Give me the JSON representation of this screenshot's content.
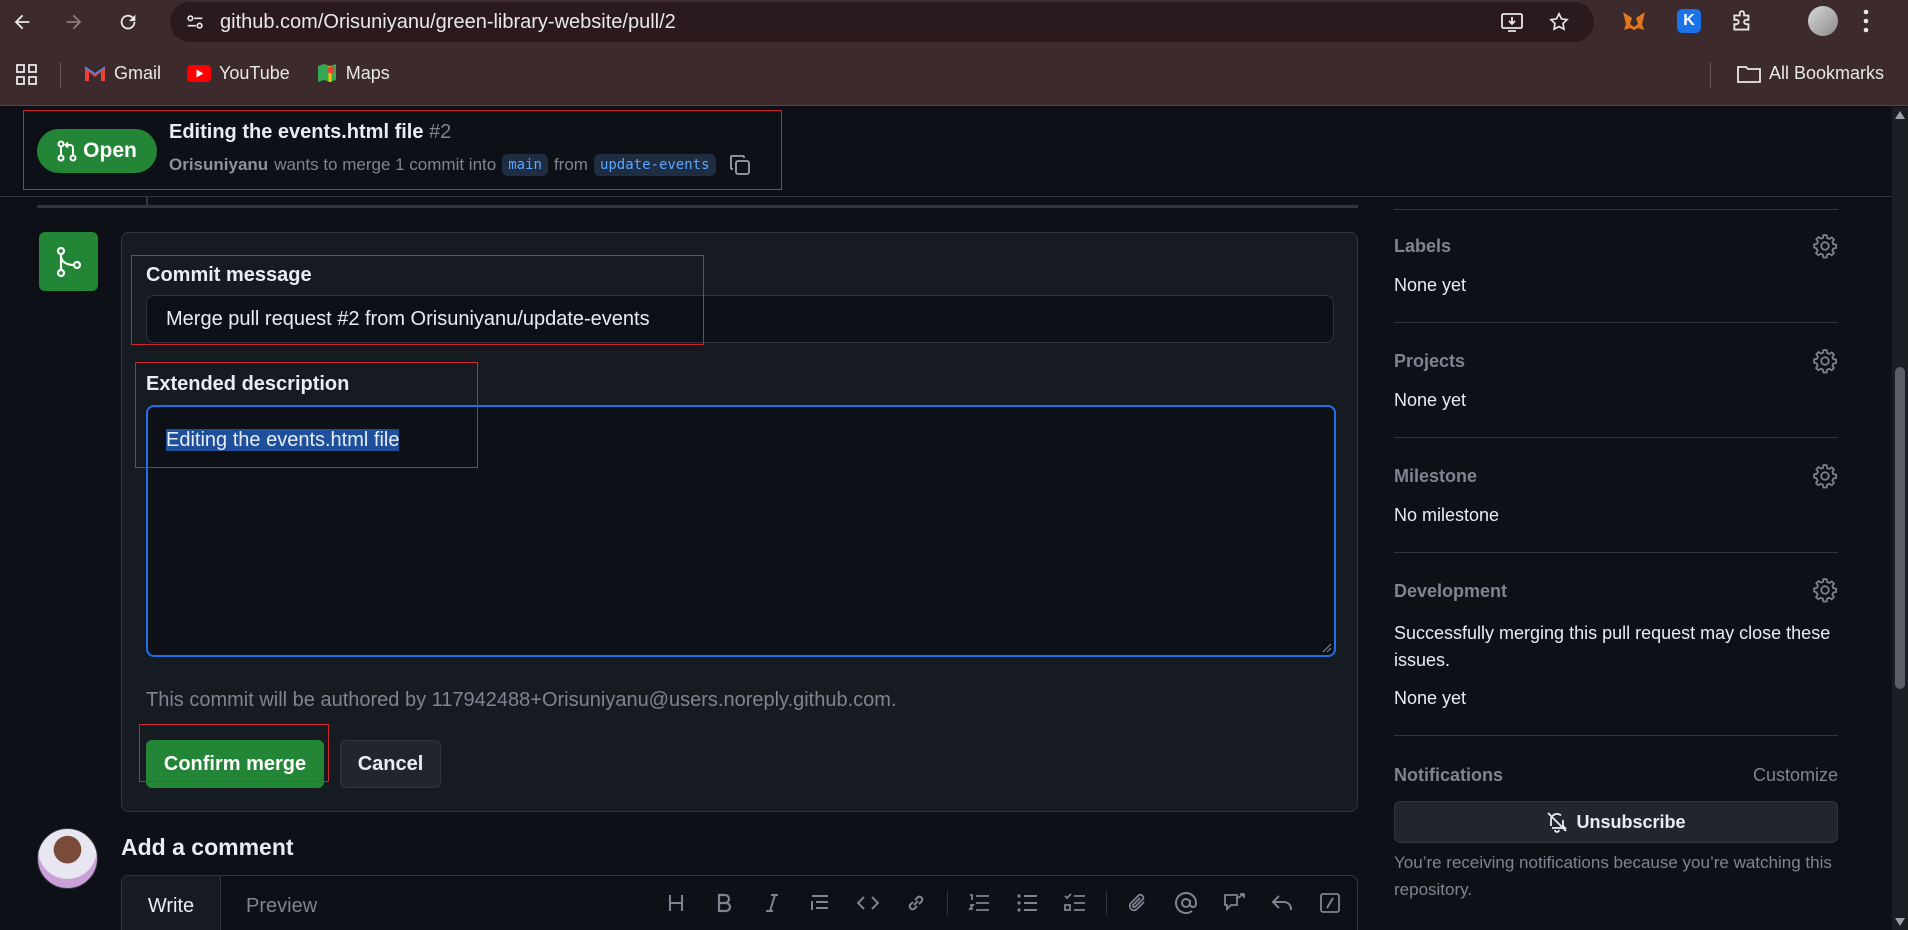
{
  "browser": {
    "url": "github.com/Orisuniyanu/green-library-website/pull/2",
    "bookmarks": [
      {
        "label": "Gmail",
        "icon": "gmail-icon"
      },
      {
        "label": "YouTube",
        "icon": "youtube-icon"
      },
      {
        "label": "Maps",
        "icon": "maps-icon"
      }
    ],
    "all_bookmarks": "All Bookmarks",
    "extension_badge": "K"
  },
  "pr": {
    "status": "Open",
    "title": "Editing the events.html file",
    "number": "#2",
    "author": "Orisuniyanu",
    "merge_text": "wants to merge 1 commit into",
    "base_branch": "main",
    "from_text": "from",
    "head_branch": "update-events"
  },
  "merge_form": {
    "commit_label": "Commit message",
    "commit_value": "Merge pull request #2 from Orisuniyanu/update-events",
    "ext_label": "Extended description",
    "ext_value": "Editing the events.html file",
    "author_note": "This commit will be authored by 117942488+Orisuniyanu@users.noreply.github.com.",
    "confirm_label": "Confirm merge",
    "cancel_label": "Cancel"
  },
  "comment": {
    "heading": "Add a comment",
    "tab_write": "Write",
    "tab_preview": "Preview"
  },
  "sidebar": {
    "labels_title": "Labels",
    "labels_value": "None yet",
    "projects_title": "Projects",
    "projects_value": "None yet",
    "milestone_title": "Milestone",
    "milestone_value": "No milestone",
    "dev_title": "Development",
    "dev_text": "Successfully merging this pull request may close these issues.",
    "dev_value": "None yet",
    "notif_title": "Notifications",
    "notif_customize": "Customize",
    "unsubscribe_label": "Unsubscribe",
    "notif_reason": "You’re receiving notifications because you’re watching this repository."
  },
  "colors": {
    "accent_green": "#238636",
    "link_blue": "#58a6ff",
    "highlight_border": "#d0232b"
  }
}
